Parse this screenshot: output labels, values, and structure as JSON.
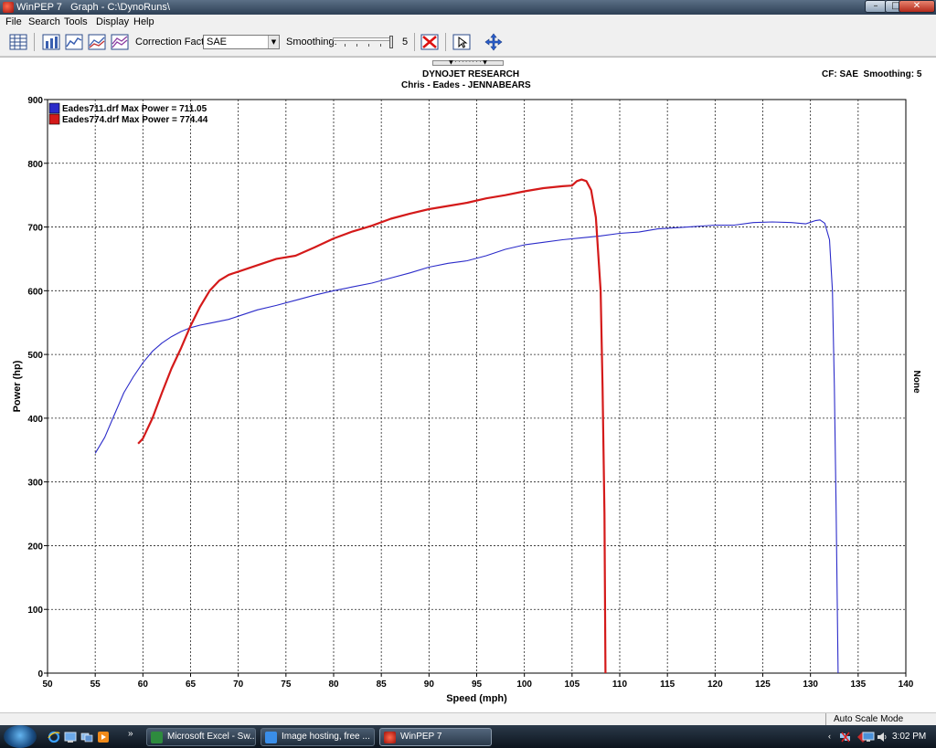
{
  "window": {
    "title": "WinPEP 7   Graph - C:\\DynoRuns\\",
    "min_glyph": "–",
    "max_glyph": "□",
    "close_glyph": "✕"
  },
  "menu": {
    "items": [
      "File",
      "Search",
      "Tools",
      "Display",
      "Help"
    ]
  },
  "toolbar": {
    "correction_label": "Correction Factor:",
    "correction_value": "SAE",
    "smoothing_label": "Smoothing:",
    "smoothing_value": "5"
  },
  "graph_header": {
    "title": "DYNOJET RESEARCH",
    "subtitle": "Chris - Eades - JENNABEARS",
    "cf_info": "CF: SAE  Smoothing: 5",
    "right_axis_label": "None"
  },
  "chart_data": {
    "type": "line",
    "title": "DYNOJET RESEARCH",
    "subtitle": "Chris - Eades - JENNABEARS",
    "xlabel": "Speed (mph)",
    "ylabel": "Power (hp)",
    "xlim": [
      50,
      140
    ],
    "ylim": [
      0,
      900
    ],
    "xticks": [
      50,
      55,
      60,
      65,
      70,
      75,
      80,
      85,
      90,
      95,
      100,
      105,
      110,
      115,
      120,
      125,
      130,
      135,
      140
    ],
    "yticks": [
      0,
      100,
      200,
      300,
      400,
      500,
      600,
      700,
      800,
      900
    ],
    "grid": true,
    "grid_style": "dashed",
    "legend_position": "top-left",
    "series": [
      {
        "name": "Eades711.drf Max Power = 711.05",
        "color": "#2b2bc9",
        "points": [
          [
            55.0,
            345
          ],
          [
            56.0,
            370
          ],
          [
            57.0,
            405
          ],
          [
            58.0,
            440
          ],
          [
            59.0,
            465
          ],
          [
            60.0,
            487
          ],
          [
            61.0,
            505
          ],
          [
            62.0,
            518
          ],
          [
            63.0,
            528
          ],
          [
            64.0,
            536
          ],
          [
            65.0,
            542
          ],
          [
            66.0,
            546
          ],
          [
            67.0,
            549
          ],
          [
            68.0,
            552
          ],
          [
            69.0,
            555
          ],
          [
            70.0,
            560
          ],
          [
            72.0,
            570
          ],
          [
            74.0,
            577
          ],
          [
            76.0,
            585
          ],
          [
            78.0,
            593
          ],
          [
            80.0,
            600
          ],
          [
            82.0,
            606
          ],
          [
            84.0,
            612
          ],
          [
            86.0,
            620
          ],
          [
            88.0,
            628
          ],
          [
            90.0,
            637
          ],
          [
            92.0,
            643
          ],
          [
            94.0,
            647
          ],
          [
            96.0,
            655
          ],
          [
            98.0,
            665
          ],
          [
            100.0,
            672
          ],
          [
            102.0,
            676
          ],
          [
            104.0,
            680
          ],
          [
            106.0,
            683
          ],
          [
            108.0,
            686
          ],
          [
            110.0,
            690
          ],
          [
            112.0,
            692
          ],
          [
            114.0,
            697
          ],
          [
            116.0,
            699
          ],
          [
            118.0,
            701
          ],
          [
            120.0,
            703
          ],
          [
            122.0,
            703
          ],
          [
            124.0,
            707
          ],
          [
            126.0,
            708
          ],
          [
            128.0,
            707
          ],
          [
            129.5,
            705
          ],
          [
            130.5,
            710
          ],
          [
            131.0,
            711.05
          ],
          [
            131.5,
            706
          ],
          [
            132.0,
            680
          ],
          [
            132.3,
            600
          ],
          [
            132.5,
            450
          ],
          [
            132.7,
            250
          ],
          [
            132.9,
            0
          ]
        ]
      },
      {
        "name": "Eades774.drf Max Power = 774.44",
        "color": "#d41a1a",
        "points": [
          [
            59.5,
            360
          ],
          [
            60.0,
            368
          ],
          [
            61.0,
            400
          ],
          [
            62.0,
            440
          ],
          [
            63.0,
            478
          ],
          [
            64.0,
            510
          ],
          [
            65.0,
            545
          ],
          [
            66.0,
            575
          ],
          [
            67.0,
            600
          ],
          [
            68.0,
            616
          ],
          [
            69.0,
            625
          ],
          [
            70.0,
            630
          ],
          [
            72.0,
            640
          ],
          [
            74.0,
            650
          ],
          [
            76.0,
            655
          ],
          [
            78.0,
            668
          ],
          [
            80.0,
            682
          ],
          [
            82.0,
            693
          ],
          [
            84.0,
            702
          ],
          [
            86.0,
            713
          ],
          [
            88.0,
            721
          ],
          [
            90.0,
            728
          ],
          [
            92.0,
            733
          ],
          [
            94.0,
            738
          ],
          [
            96.0,
            745
          ],
          [
            98.0,
            750
          ],
          [
            100.0,
            756
          ],
          [
            102.0,
            761
          ],
          [
            104.0,
            764
          ],
          [
            105.0,
            765
          ],
          [
            105.5,
            772
          ],
          [
            106.0,
            774.44
          ],
          [
            106.5,
            772
          ],
          [
            107.0,
            758
          ],
          [
            107.5,
            715
          ],
          [
            108.0,
            600
          ],
          [
            108.2,
            450
          ],
          [
            108.4,
            250
          ],
          [
            108.5,
            0
          ]
        ]
      }
    ]
  },
  "status": {
    "mode": "Auto Scale Mode"
  },
  "taskbar": {
    "tasks": [
      "Microsoft Excel - Sw...",
      "Image hosting, free ...",
      "WinPEP 7"
    ],
    "overflow": "»",
    "clock": "3:02 PM"
  }
}
